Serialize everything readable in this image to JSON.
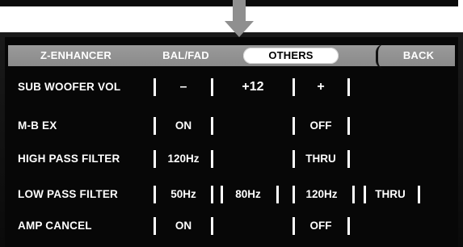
{
  "tabs": [
    {
      "label": "Z-ENHANCER"
    },
    {
      "label": "BAL/FAD"
    },
    {
      "label": "OTHERS"
    },
    {
      "label": "BACK"
    }
  ],
  "rows": [
    {
      "label": "SUB WOOFER VOL",
      "options": [
        "–",
        "+12",
        "+"
      ]
    },
    {
      "label": "M-B EX",
      "options": [
        "ON",
        "OFF"
      ]
    },
    {
      "label": "HIGH PASS FILTER",
      "options": [
        "120Hz",
        "THRU"
      ]
    },
    {
      "label": "LOW PASS FILTER",
      "options": [
        "50Hz",
        "80Hz",
        "120Hz",
        "THRU"
      ]
    },
    {
      "label": "AMP CANCEL",
      "options": [
        "ON",
        "OFF"
      ]
    }
  ],
  "colors": {
    "tabbar": "#8f8f8f",
    "text": "#ffffff",
    "background": "#070707",
    "arrow": "#8f8f8f"
  },
  "icons": {
    "pointer": "down-arrow-icon"
  }
}
